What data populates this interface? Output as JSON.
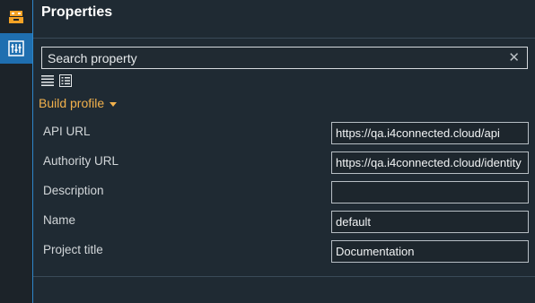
{
  "panel": {
    "title": "Properties"
  },
  "search": {
    "placeholder": "Search property",
    "clear_icon": "close-icon"
  },
  "view_icons": [
    "categorized-view-icon",
    "alphabetical-view-icon"
  ],
  "group": {
    "label": "Build profile"
  },
  "properties": [
    {
      "label": "API URL",
      "value": "https://qa.i4connected.cloud/api"
    },
    {
      "label": "Authority URL",
      "value": "https://qa.i4connected.cloud/identity"
    },
    {
      "label": "Description",
      "value": ""
    },
    {
      "label": "Name",
      "value": "default"
    },
    {
      "label": "Project title",
      "value": "Documentation"
    }
  ],
  "colors": {
    "accent": "#1f6fb0",
    "group_label": "#f2b14c",
    "background": "#1f2a33"
  }
}
